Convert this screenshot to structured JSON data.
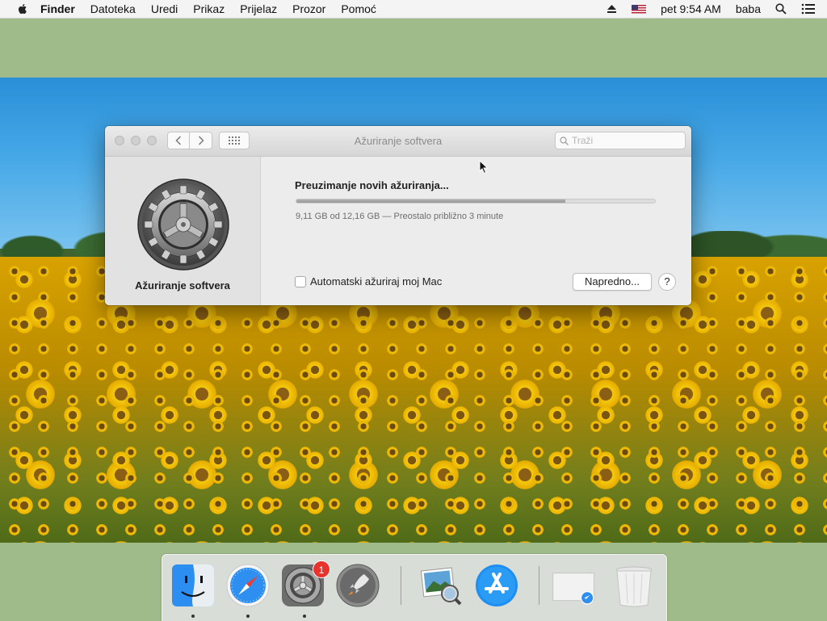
{
  "menubar": {
    "app_name": "Finder",
    "items": [
      "Datoteka",
      "Uredi",
      "Prikaz",
      "Prijelaz",
      "Prozor",
      "Pomoć"
    ],
    "clock": "pet 9:54 AM",
    "user": "baba"
  },
  "window": {
    "title": "Ažuriranje softvera",
    "search_placeholder": "Traži",
    "sidebar_label": "Ažuriranje softvera",
    "status": "Preuzimanje novih ažuriranja...",
    "progress_fraction": 0.75,
    "detail": "9,11 GB od 12,16 GB — Preostalo približno 3 minute",
    "auto_update_label": "Automatski ažuriraj moj Mac",
    "auto_update_checked": false,
    "advanced_button": "Napredno...",
    "help_button": "?"
  },
  "dock": {
    "system_prefs_badge": "1",
    "items": [
      "finder-icon",
      "safari-icon",
      "system-preferences-icon",
      "launchpad-icon",
      "preview-icon",
      "app-store-icon",
      "downloads-stack-icon",
      "trash-icon"
    ]
  }
}
